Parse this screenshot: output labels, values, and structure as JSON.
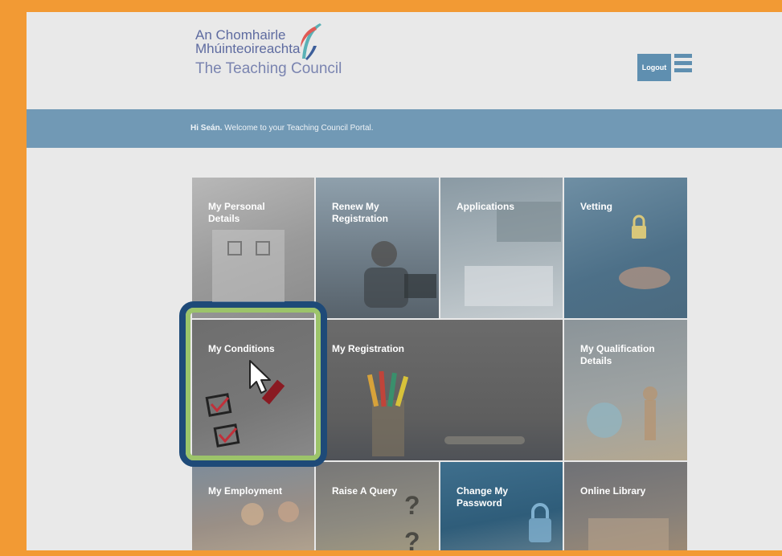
{
  "header": {
    "logo": {
      "line1": "An Chomhairle",
      "line2": "Mhúinteoireachta",
      "line3": "The Teaching Council"
    },
    "logout_label": "Logout",
    "menu_icon": "hamburger-menu-icon"
  },
  "welcome": {
    "name": "Hi Seán.",
    "message": " Welcome to your Teaching Council Portal."
  },
  "tiles": [
    {
      "label": "My Personal Details"
    },
    {
      "label": "Renew My Registration"
    },
    {
      "label": "Applications"
    },
    {
      "label": "Vetting"
    },
    {
      "label": "My Conditions"
    },
    {
      "label": "My Registration"
    },
    {
      "label": "My Qualification Details"
    },
    {
      "label": "My Employment"
    },
    {
      "label": "Raise A Query"
    },
    {
      "label": "Change My Password"
    },
    {
      "label": "Online Library"
    }
  ],
  "colors": {
    "outer_border": "#f29a34",
    "welcome_bar": "#7199b5",
    "logout_button": "#5f8fb0",
    "highlight_outer": "#1e4a78",
    "highlight_inner": "#9cc46a"
  }
}
